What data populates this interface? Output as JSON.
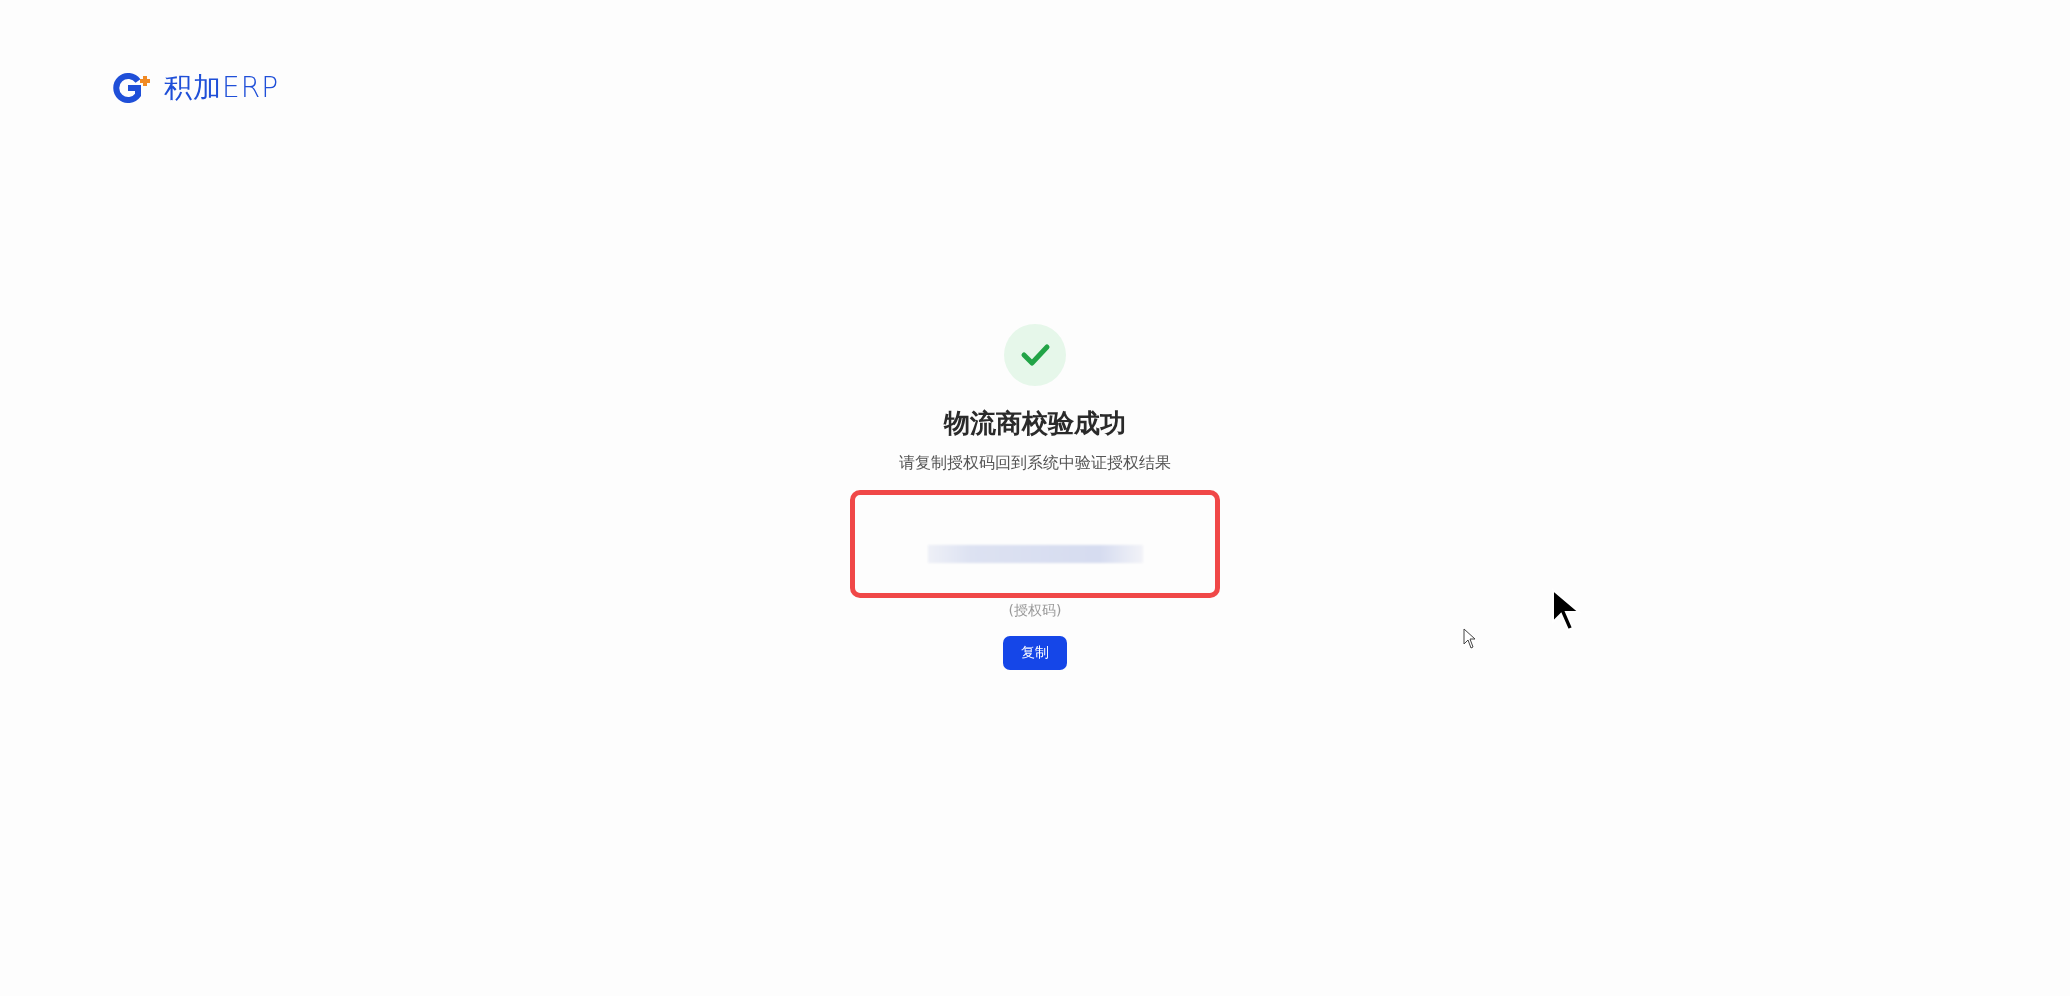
{
  "header": {
    "logo_text": "积加ERP"
  },
  "result": {
    "kind": "success",
    "title": "物流商校验成功",
    "message": "请复制授权码回到系统中验证授权结果",
    "code_label": "(授权码)",
    "highlighted": true
  },
  "buttons": [
    {
      "label": "复制"
    }
  ]
}
